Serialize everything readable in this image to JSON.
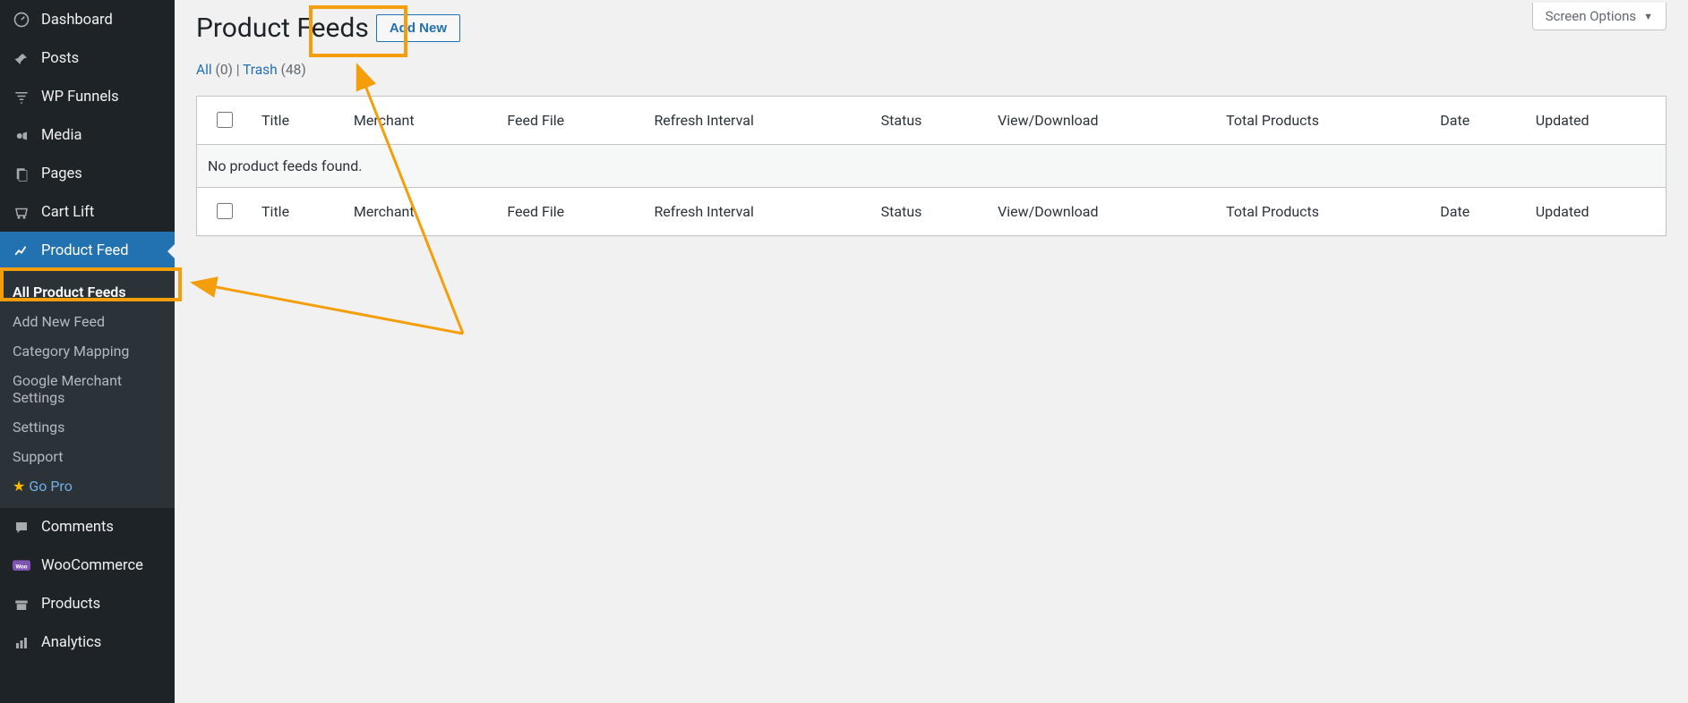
{
  "sidebar": {
    "dashboard": "Dashboard",
    "posts": "Posts",
    "wpfunnels": "WP Funnels",
    "media": "Media",
    "pages": "Pages",
    "cartlift": "Cart Lift",
    "productfeed": "Product Feed",
    "comments": "Comments",
    "woocommerce": "WooCommerce",
    "products": "Products",
    "analytics": "Analytics",
    "submenu": {
      "all": "All Product Feeds",
      "addnew": "Add New Feed",
      "category": "Category Mapping",
      "gms": "Google Merchant Settings",
      "settings": "Settings",
      "support": "Support",
      "gopro": "Go Pro"
    }
  },
  "screen_options": "Screen Options",
  "page_title": "Product Feeds",
  "add_new_button": "Add New",
  "filters": {
    "all_label": "All",
    "all_count": "(0)",
    "sep": " | ",
    "trash_label": "Trash",
    "trash_count": "(48)"
  },
  "columns": {
    "title": "Title",
    "merchant": "Merchant",
    "feedfile": "Feed File",
    "refresh": "Refresh Interval",
    "status": "Status",
    "viewdl": "View/Download",
    "total": "Total Products",
    "date": "Date",
    "updated": "Updated"
  },
  "empty_message": "No product feeds found."
}
